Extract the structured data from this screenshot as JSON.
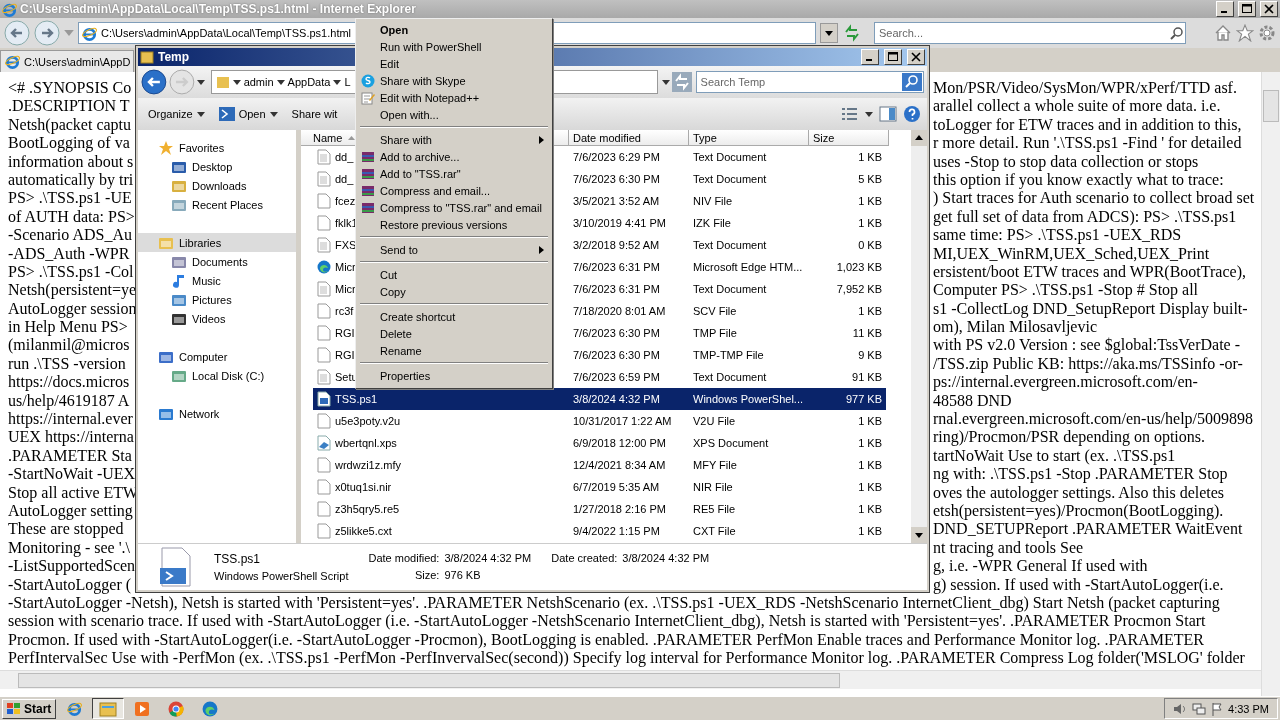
{
  "browser": {
    "title": "C:\\Users\\admin\\AppData\\Local\\Temp\\TSS.ps1.html - Internet Explorer",
    "address": "C:\\Users\\admin\\AppData\\Local\\Temp\\TSS.ps1.html",
    "search_placeholder": "Search...",
    "tab": "C:\\Users\\admin\\AppD"
  },
  "page": {
    "lines": [
      {
        "kind": "split",
        "left": "<# .SYNOPSIS Co",
        "right": "Mon/PSR/Video/SysMon/WPR/xPerf/TTD asf."
      },
      {
        "kind": "split",
        "left": ".DESCRIPTION T",
        "right": "arallel collect a whole suite of more data. i.e."
      },
      {
        "kind": "split",
        "left": "Netsh(packet captu",
        "right": "toLogger for ETW traces and in addition to this,"
      },
      {
        "kind": "split",
        "left": "BootLogging of va",
        "right": "r more detail. Run '.\\TSS.ps1 -Find ' for detailed"
      },
      {
        "kind": "split",
        "left": "information about s",
        "right": "uses -Stop to stop data collection or stops"
      },
      {
        "kind": "split",
        "left": "automatically by tri",
        "right": "this option if you know exactly what to trace:"
      },
      {
        "kind": "split",
        "left": "PS> .\\TSS.ps1 -UE",
        "right": ") Start traces for Auth scenario to collect broad set"
      },
      {
        "kind": "split",
        "left": "of AUTH data: PS>",
        "right": "get full set of data from ADCS): PS> .\\TSS.ps1"
      },
      {
        "kind": "split",
        "left": "-Scenario ADS_Au",
        "right": "same time: PS> .\\TSS.ps1 -UEX_RDS"
      },
      {
        "kind": "split",
        "left": "-ADS_Auth -WPR",
        "right": "MI,UEX_WinRM,UEX_Sched,UEX_Print"
      },
      {
        "kind": "split",
        "left": "PS> .\\TSS.ps1 -Col",
        "right": "ersistent/boot ETW traces and WPR(BootTrace),"
      },
      {
        "kind": "split",
        "left": "Netsh(persistent=ye",
        "right": "Computer PS> .\\TSS.ps1 -Stop # Stop all"
      },
      {
        "kind": "split",
        "left": "AutoLogger session",
        "right": "s1 -CollectLog DND_SetupReport Display built-"
      },
      {
        "kind": "split",
        "left": "in Help Menu PS>",
        "right": "om), Milan Milosavljevic"
      },
      {
        "kind": "split",
        "left": "(milanmil@micros",
        "right": "with PS v2.0 Version : see $global:TssVerDate -"
      },
      {
        "kind": "split",
        "left": "run .\\TSS -version",
        "right": "/TSS.zip Public KB: https://aka.ms/TSSinfo -or-"
      },
      {
        "kind": "split",
        "left": "https://docs.micros",
        "right": "ps://internal.evergreen.microsoft.com/en-"
      },
      {
        "kind": "split",
        "left": "us/help/4619187 A",
        "right": "48588 DND"
      },
      {
        "kind": "split",
        "left": "https://internal.ever",
        "right": "rnal.evergreen.microsoft.com/en-us/help/5009898"
      },
      {
        "kind": "split",
        "left": "UEX https://interna",
        "right": "ring)/Procmon/PSR depending on options."
      },
      {
        "kind": "split",
        "left": ".PARAMETER Sta",
        "right": "tartNoWait Use to start (ex. .\\TSS.ps1"
      },
      {
        "kind": "split",
        "left": "-StartNoWait -UEX",
        "right": "ng with: .\\TSS.ps1 -Stop .PARAMETER Stop"
      },
      {
        "kind": "split",
        "left": "Stop all active ETW",
        "right": "oves the autologger settings. Also this deletes"
      },
      {
        "kind": "split",
        "left": "AutoLogger setting",
        "right": "etsh(persistent=yes)/Procmon(BootLogging)."
      },
      {
        "kind": "split",
        "left": "These are stopped",
        "right": "DND_SETUPReport .PARAMETER WaitEvent"
      },
      {
        "kind": "split",
        "left": "Monitoring - see '.\\",
        "right": "nt tracing and tools See"
      },
      {
        "kind": "split",
        "left": "-ListSupportedScen",
        "right": "g, i.e. -WPR General If used with"
      },
      {
        "kind": "split",
        "left": "-StartAutoLogger (",
        "right": "g) session. If used with -StartAutoLogger(i.e."
      },
      {
        "kind": "full",
        "text": "-StartAutoLogger -Netsh), Netsh is started with 'Persistent=yes'. .PARAMETER NetshScenario (ex. .\\TSS.ps1 -UEX_RDS -NetshScenario InternetClient_dbg) Start Netsh (packet capturing"
      },
      {
        "kind": "full",
        "text": "session with scenario trace. If used with -StartAutoLogger (i.e. -StartAutoLogger -NetshScenario InternetClient_dbg), Netsh is started with 'Persistent=yes'. .PARAMETER Procmon Start"
      },
      {
        "kind": "full",
        "text": "Procmon. If used with -StartAutoLogger(i.e. -StartAutoLogger -Procmon), BootLogging is enabled. .PARAMETER PerfMon Enable traces and Performance Monitor log. .PARAMETER"
      },
      {
        "kind": "full",
        "text": "PerfIntervalSec Use with -PerfMon (ex. .\\TSS.ps1 -PerfMon -PerfInvervalSec(second)) Specify log interval for Performance Monitor log. .PARAMETER Compress Log folder('MSLOG' folder"
      }
    ]
  },
  "explorer": {
    "title": "Temp",
    "breadcrumb": [
      "admin",
      "AppData",
      "L"
    ],
    "search_placeholder": "Search Temp",
    "toolbar": [
      {
        "label": "Organize",
        "kind": "plain",
        "caret": true
      },
      {
        "label": "Open",
        "kind": "powershell",
        "caret": true
      },
      {
        "label": "Share wit",
        "kind": "plain",
        "caret": false
      }
    ],
    "tree": [
      {
        "label": "Favorites",
        "kind": "star",
        "selected": false,
        "children": [
          {
            "label": "Desktop",
            "kind": "desktop",
            "selected": false
          },
          {
            "label": "Downloads",
            "kind": "downloads",
            "selected": false
          },
          {
            "label": "Recent Places",
            "kind": "recent",
            "selected": false
          }
        ]
      },
      {
        "label": "Libraries",
        "kind": "libraries",
        "selected": true,
        "children": [
          {
            "label": "Documents",
            "kind": "documents",
            "selected": false
          },
          {
            "label": "Music",
            "kind": "music",
            "selected": false
          },
          {
            "label": "Pictures",
            "kind": "pictures",
            "selected": false
          },
          {
            "label": "Videos",
            "kind": "videos",
            "selected": false
          }
        ]
      },
      {
        "label": "Computer",
        "kind": "computer",
        "selected": false,
        "children": [
          {
            "label": "Local Disk (C:)",
            "kind": "disk",
            "selected": false
          }
        ]
      },
      {
        "label": "Network",
        "kind": "network",
        "selected": false
      }
    ],
    "columns": [
      {
        "label": "Name",
        "sorted": true
      },
      {
        "label": "Date modified",
        "sorted": false
      },
      {
        "label": "Type",
        "sorted": false
      },
      {
        "label": "Size",
        "sorted": false
      }
    ],
    "files": [
      {
        "name": "dd_",
        "date": "7/6/2023 6:29 PM",
        "type": "Text Document",
        "size": "1 KB",
        "kind": "text",
        "selected": false
      },
      {
        "name": "dd_",
        "date": "7/6/2023 6:30 PM",
        "type": "Text Document",
        "size": "5 KB",
        "kind": "text",
        "selected": false
      },
      {
        "name": "fcez",
        "date": "3/5/2021 3:52 AM",
        "type": "NIV File",
        "size": "1 KB",
        "kind": "blank",
        "selected": false
      },
      {
        "name": "fklk1",
        "date": "3/10/2019 4:41 PM",
        "type": "IZK File",
        "size": "1 KB",
        "kind": "blank",
        "selected": false
      },
      {
        "name": "FXS",
        "date": "3/2/2018 9:52 AM",
        "type": "Text Document",
        "size": "0 KB",
        "kind": "text",
        "selected": false
      },
      {
        "name": "Micr",
        "date": "7/6/2023 6:31 PM",
        "type": "Microsoft Edge HTM...",
        "size": "1,023 KB",
        "kind": "edge",
        "selected": false
      },
      {
        "name": "Micr",
        "date": "7/6/2023 6:31 PM",
        "type": "Text Document",
        "size": "7,952 KB",
        "kind": "text",
        "selected": false
      },
      {
        "name": "rc3f",
        "date": "7/18/2020 8:01 AM",
        "type": "SCV File",
        "size": "1 KB",
        "kind": "blank",
        "selected": false
      },
      {
        "name": "RGI",
        "date": "7/6/2023 6:30 PM",
        "type": "TMP File",
        "size": "11 KB",
        "kind": "blank",
        "selected": false
      },
      {
        "name": "RGI",
        "date": "7/6/2023 6:30 PM",
        "type": "TMP-TMP File",
        "size": "9 KB",
        "kind": "blank",
        "selected": false
      },
      {
        "name": "Setu",
        "date": "7/6/2023 6:59 PM",
        "type": "Text Document",
        "size": "91 KB",
        "kind": "text",
        "selected": false
      },
      {
        "name": "TSS.ps1",
        "date": "3/8/2024 4:32 PM",
        "type": "Windows PowerShel...",
        "size": "977 KB",
        "kind": "script",
        "selected": true
      },
      {
        "name": "u5e3poty.v2u",
        "date": "10/31/2017 1:22 AM",
        "type": "V2U File",
        "size": "1 KB",
        "kind": "blank",
        "selected": false
      },
      {
        "name": "wbertqnl.xps",
        "date": "6/9/2018 12:00 PM",
        "type": "XPS Document",
        "size": "1 KB",
        "kind": "xps",
        "selected": false
      },
      {
        "name": "wrdwzi1z.mfy",
        "date": "12/4/2021 8:34 AM",
        "type": "MFY File",
        "size": "1 KB",
        "kind": "blank",
        "selected": false
      },
      {
        "name": "x0tuq1si.nir",
        "date": "6/7/2019 5:35 AM",
        "type": "NIR File",
        "size": "1 KB",
        "kind": "blank",
        "selected": false
      },
      {
        "name": "z3h5qry5.re5",
        "date": "1/27/2018 2:16 PM",
        "type": "RE5 File",
        "size": "1 KB",
        "kind": "blank",
        "selected": false
      },
      {
        "name": "z5likke5.cxt",
        "date": "9/4/2022 1:15 PM",
        "type": "CXT File",
        "size": "1 KB",
        "kind": "blank",
        "selected": false
      }
    ],
    "details": {
      "name": "TSS.ps1",
      "type": "Windows PowerShell Script",
      "fields": [
        [
          {
            "label": "Date modified:",
            "value": "3/8/2024 4:32 PM"
          },
          {
            "label": "Size:",
            "value": "976 KB"
          }
        ],
        [
          {
            "label": "Date created:",
            "value": "3/8/2024 4:32 PM"
          }
        ]
      ]
    }
  },
  "context_menu": {
    "groups": [
      [
        {
          "label": "Open",
          "kind": "plain",
          "default": true,
          "submenu": false
        },
        {
          "label": "Run with PowerShell",
          "kind": "plain",
          "default": false,
          "submenu": false
        },
        {
          "label": "Edit",
          "kind": "plain",
          "default": false,
          "submenu": false
        },
        {
          "label": "Share with Skype",
          "kind": "skype",
          "default": false,
          "submenu": false
        },
        {
          "label": "Edit with Notepad++",
          "kind": "notepad",
          "default": false,
          "submenu": false
        },
        {
          "label": "Open with...",
          "kind": "plain",
          "default": false,
          "submenu": false
        }
      ],
      [
        {
          "label": "Share with",
          "kind": "plain",
          "default": false,
          "submenu": true
        },
        {
          "label": "Add to archive...",
          "kind": "archive",
          "default": false,
          "submenu": false
        },
        {
          "label": "Add to \"TSS.rar\"",
          "kind": "archive",
          "default": false,
          "submenu": false
        },
        {
          "label": "Compress and email...",
          "kind": "archive",
          "default": false,
          "submenu": false
        },
        {
          "label": "Compress to \"TSS.rar\" and email",
          "kind": "archive",
          "default": false,
          "submenu": false
        },
        {
          "label": "Restore previous versions",
          "kind": "plain",
          "default": false,
          "submenu": false
        }
      ],
      [
        {
          "label": "Send to",
          "kind": "plain",
          "default": false,
          "submenu": true
        }
      ],
      [
        {
          "label": "Cut",
          "kind": "plain",
          "default": false,
          "submenu": false
        },
        {
          "label": "Copy",
          "kind": "plain",
          "default": false,
          "submenu": false
        }
      ],
      [
        {
          "label": "Create shortcut",
          "kind": "plain",
          "default": false,
          "submenu": false
        },
        {
          "label": "Delete",
          "kind": "plain",
          "default": false,
          "submenu": false
        },
        {
          "label": "Rename",
          "kind": "plain",
          "default": false,
          "submenu": false
        }
      ],
      [
        {
          "label": "Properties",
          "kind": "plain",
          "default": false,
          "submenu": false
        }
      ]
    ]
  },
  "taskbar": {
    "start": "Start",
    "apps": [
      {
        "kind": "ie",
        "active": false
      },
      {
        "kind": "explorer",
        "active": true
      },
      {
        "kind": "media",
        "active": false
      },
      {
        "kind": "chrome",
        "active": false
      },
      {
        "kind": "edge",
        "active": false
      }
    ],
    "time": "4:33 PM"
  }
}
